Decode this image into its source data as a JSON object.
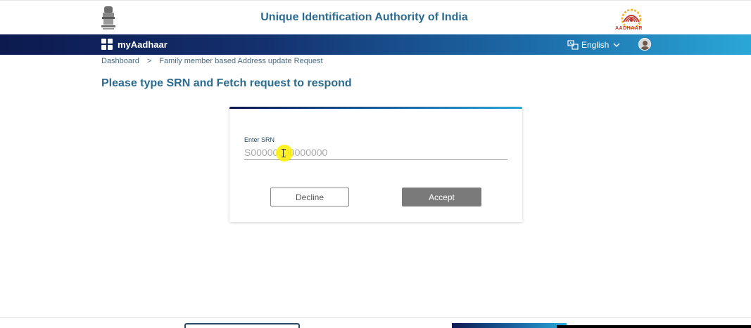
{
  "header": {
    "org_title": "Unique Identification Authority of India",
    "logo_text": "AADHAAR"
  },
  "navbar": {
    "app_name": "myAadhaar",
    "language": "English"
  },
  "breadcrumb": {
    "items": [
      "Dashboard",
      "Family member based Address update Request"
    ],
    "separator": ">"
  },
  "page": {
    "title": "Please type SRN and Fetch request to respond"
  },
  "form": {
    "srn_label": "Enter SRN",
    "srn_placeholder": "S00000000000000",
    "decline_label": "Decline",
    "accept_label": "Accept"
  },
  "colors": {
    "title_blue": "#2b6b8f",
    "nav_dark": "#0c1a4f",
    "nav_light": "#2aa7d7",
    "accept_gray": "#7a7a7a"
  }
}
